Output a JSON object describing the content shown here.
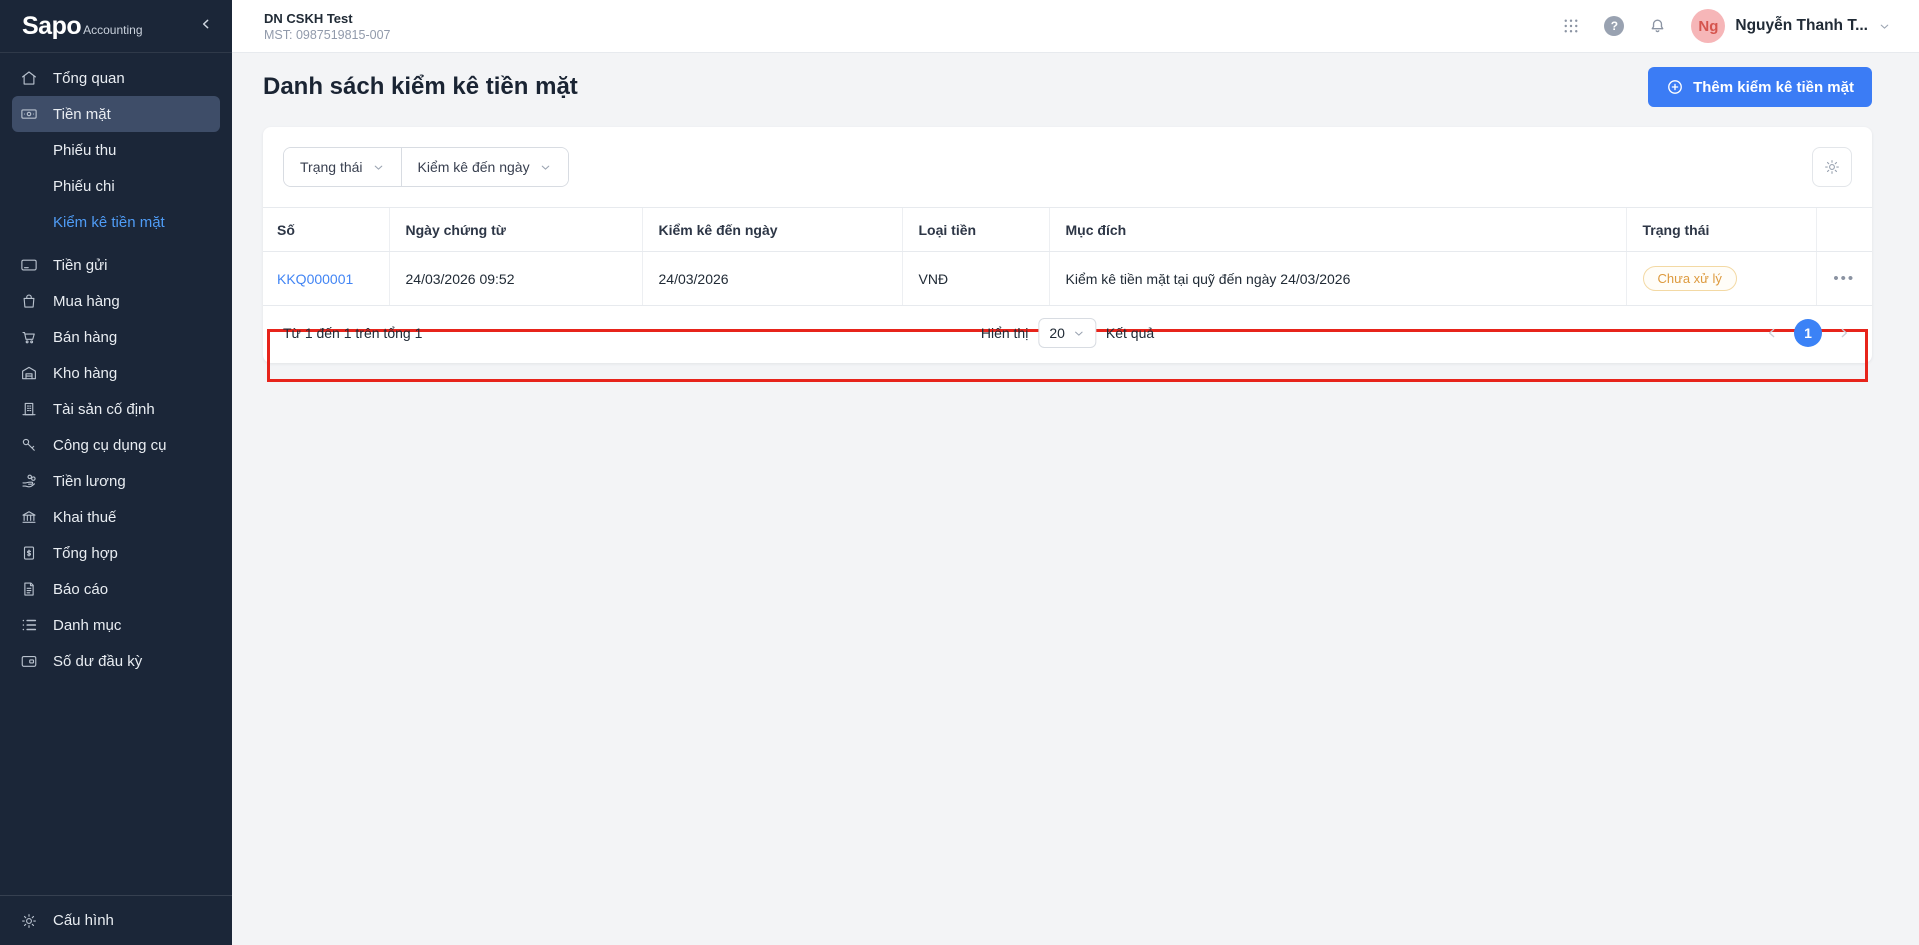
{
  "brand": {
    "name": "Sapo",
    "suffix": "Accounting"
  },
  "sidebar": {
    "items": [
      {
        "label": "Tổng quan",
        "icon": "home-icon"
      },
      {
        "label": "Tiền mặt",
        "icon": "banknote-icon",
        "active": true
      },
      {
        "label": "Phiếu thu",
        "sub": true
      },
      {
        "label": "Phiếu chi",
        "sub": true
      },
      {
        "label": "Kiểm kê tiền mặt",
        "sub": true,
        "active": true
      },
      {
        "label": "Tiền gửi",
        "icon": "bank-card-icon"
      },
      {
        "label": "Mua hàng",
        "icon": "shopping-bag-icon"
      },
      {
        "label": "Bán hàng",
        "icon": "shopping-cart-icon"
      },
      {
        "label": "Kho hàng",
        "icon": "warehouse-icon"
      },
      {
        "label": "Tài sản cố định",
        "icon": "building-icon"
      },
      {
        "label": "Công cụ dụng cụ",
        "icon": "tool-icon"
      },
      {
        "label": "Tiền lương",
        "icon": "salary-icon"
      },
      {
        "label": "Khai thuế",
        "icon": "tax-bank-icon"
      },
      {
        "label": "Tổng hợp",
        "icon": "ledger-icon"
      },
      {
        "label": "Báo cáo",
        "icon": "report-icon"
      },
      {
        "label": "Danh mục",
        "icon": "list-icon"
      },
      {
        "label": "Số dư đầu kỳ",
        "icon": "wallet-icon"
      }
    ],
    "footer_item": {
      "label": "Cấu hình",
      "icon": "gear-icon"
    }
  },
  "topbar": {
    "company_name": "DN CSKH Test",
    "company_tax_label": "MST: 0987519815-007",
    "help_glyph": "?",
    "user": {
      "initials": "Ng",
      "name": "Nguyễn Thanh T..."
    }
  },
  "page": {
    "title": "Danh sách kiểm kê tiền mặt",
    "add_button_label": "Thêm kiểm kê tiền mặt"
  },
  "filters": {
    "status_label": "Trạng thái",
    "date_label": "Kiểm kê đến ngày"
  },
  "table": {
    "columns": [
      "Số",
      "Ngày chứng từ",
      "Kiểm kê đến ngày",
      "Loại tiền",
      "Mục đích",
      "Trạng thái"
    ],
    "rows": [
      {
        "code": "KKQ000001",
        "doc_datetime": "24/03/2026 09:52",
        "audit_date": "24/03/2026",
        "currency": "VNĐ",
        "purpose": "Kiểm kê tiền mặt tại quỹ đến ngày 24/03/2026",
        "status": "Chưa xử lý",
        "menu_glyph": "•••"
      }
    ]
  },
  "pagination": {
    "summary": "Từ 1 đến 1 trên tổng 1",
    "show_label": "Hiển thị",
    "page_size": "20",
    "results_label": "Kết quả",
    "current_page": "1"
  },
  "colors": {
    "accent_blue": "#3b7cf5",
    "sidebar_bg": "#1b2638",
    "sidebar_active_bg": "#3e4d68",
    "active_link_blue": "#4f9cf6",
    "row_link_blue": "#4285f4",
    "status_orange": "#dd9a3e",
    "highlight_red": "#e7241b",
    "page_bg": "#f3f4f6"
  }
}
